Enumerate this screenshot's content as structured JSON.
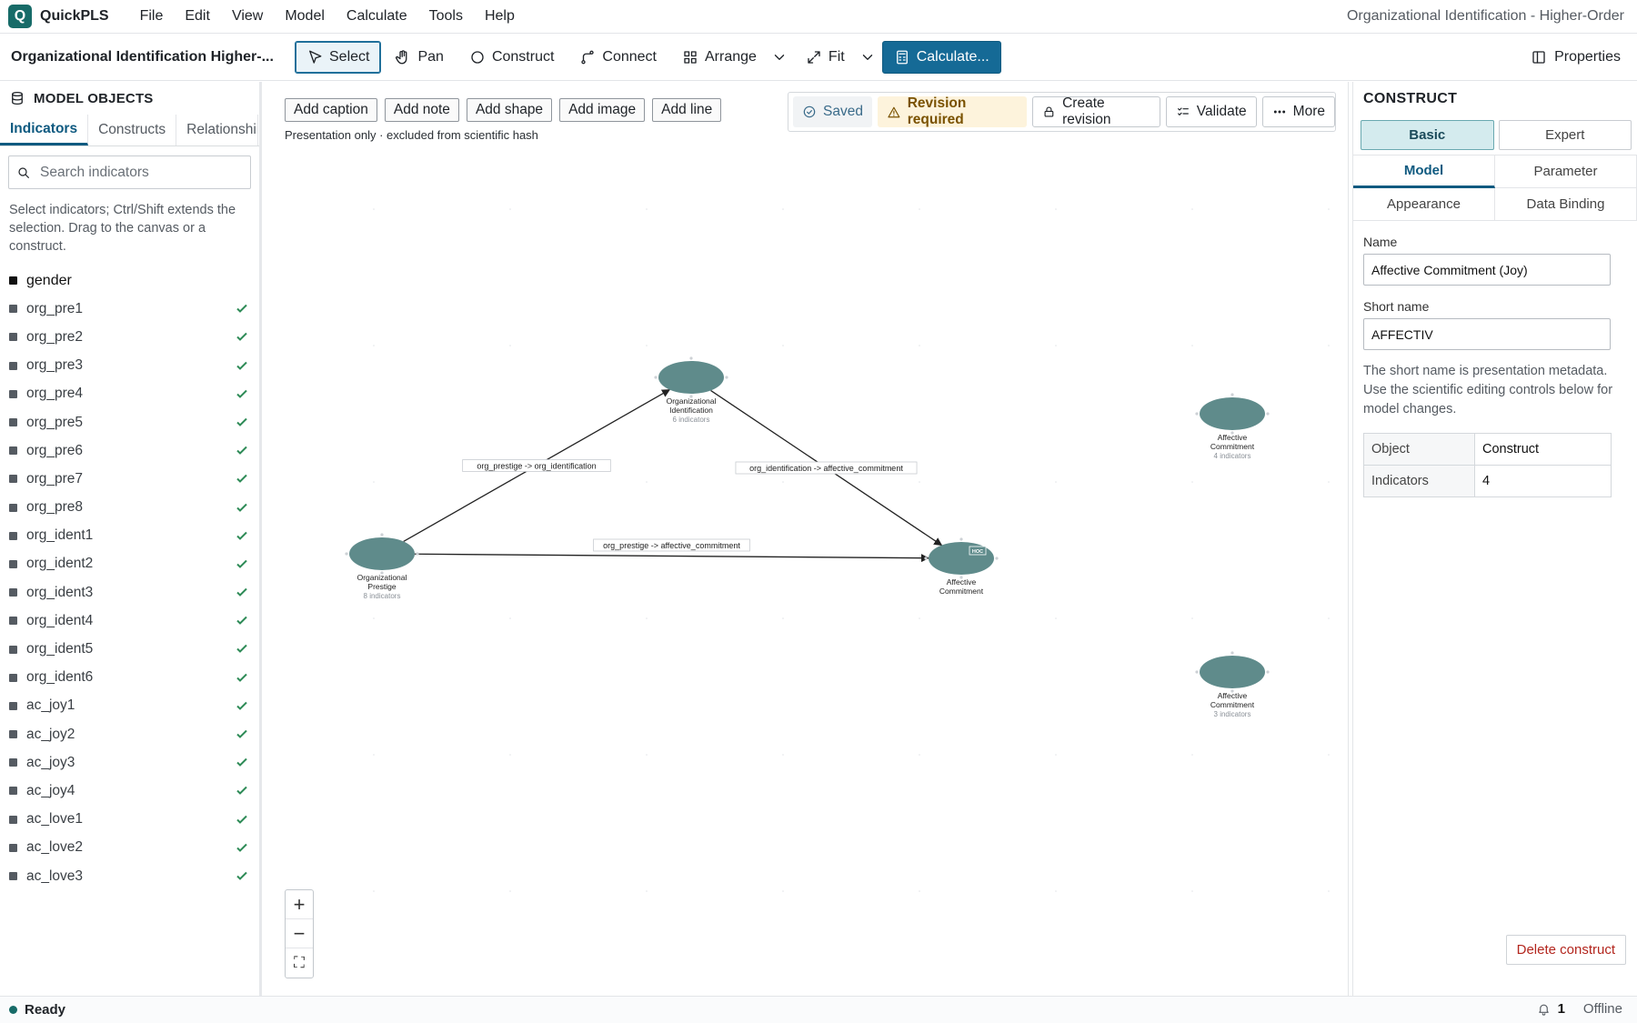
{
  "app": {
    "name": "QuickPLS",
    "logo_letter": "Q",
    "window_title": "Organizational Identification - Higher-Order"
  },
  "menu": [
    "File",
    "Edit",
    "View",
    "Model",
    "Calculate",
    "Tools",
    "Help"
  ],
  "toolbar": {
    "model_title": "Organizational Identification Higher-...",
    "select": "Select",
    "pan": "Pan",
    "construct": "Construct",
    "connect": "Connect",
    "arrange": "Arrange",
    "fit": "Fit",
    "calculate": "Calculate...",
    "properties": "Properties"
  },
  "left_panel": {
    "title": "MODEL OBJECTS",
    "tabs": [
      "Indicators",
      "Constructs",
      "Relationshi..."
    ],
    "search_placeholder": "Search indicators",
    "hint": "Select indicators; Ctrl/Shift extends the selection. Drag to the canvas or a construct.",
    "indicators": [
      {
        "name": "gender",
        "assigned": false
      },
      {
        "name": "org_pre1",
        "assigned": true
      },
      {
        "name": "org_pre2",
        "assigned": true
      },
      {
        "name": "org_pre3",
        "assigned": true
      },
      {
        "name": "org_pre4",
        "assigned": true
      },
      {
        "name": "org_pre5",
        "assigned": true
      },
      {
        "name": "org_pre6",
        "assigned": true
      },
      {
        "name": "org_pre7",
        "assigned": true
      },
      {
        "name": "org_pre8",
        "assigned": true
      },
      {
        "name": "org_ident1",
        "assigned": true
      },
      {
        "name": "org_ident2",
        "assigned": true
      },
      {
        "name": "org_ident3",
        "assigned": true
      },
      {
        "name": "org_ident4",
        "assigned": true
      },
      {
        "name": "org_ident5",
        "assigned": true
      },
      {
        "name": "org_ident6",
        "assigned": true
      },
      {
        "name": "ac_joy1",
        "assigned": true
      },
      {
        "name": "ac_joy2",
        "assigned": true
      },
      {
        "name": "ac_joy3",
        "assigned": true
      },
      {
        "name": "ac_joy4",
        "assigned": true
      },
      {
        "name": "ac_love1",
        "assigned": true
      },
      {
        "name": "ac_love2",
        "assigned": true
      },
      {
        "name": "ac_love3",
        "assigned": true
      }
    ]
  },
  "canvas": {
    "buttons": [
      "Add caption",
      "Add note",
      "Add shape",
      "Add image",
      "Add line"
    ],
    "note": "Presentation only · excluded from scientific hash",
    "status": {
      "saved": "Saved",
      "revision": "Revision required",
      "create_revision": "Create revision",
      "validate": "Validate",
      "more": "More"
    },
    "nodes": [
      {
        "id": "oi",
        "label_lines": [
          "Organizational",
          "Identification"
        ],
        "sub": "6 indicators"
      },
      {
        "id": "op",
        "label_lines": [
          "Organizational",
          "Prestige"
        ],
        "sub": "8 indicators"
      },
      {
        "id": "ac",
        "label_lines": [
          "Affective",
          "Commitment"
        ],
        "sub": "",
        "badge": "HOC"
      },
      {
        "id": "acj",
        "label_lines": [
          "Affective",
          "Commitment"
        ],
        "sub": "4 indicators"
      },
      {
        "id": "acl",
        "label_lines": [
          "Affective",
          "Commitment"
        ],
        "sub": "3 indicators"
      }
    ],
    "paths": [
      {
        "from": "op",
        "to": "oi",
        "label": "org_prestige -> org_identification"
      },
      {
        "from": "oi",
        "to": "ac",
        "label": "org_identification -> affective_commitment"
      },
      {
        "from": "op",
        "to": "ac",
        "label": "org_prestige -> affective_commitment"
      }
    ],
    "zoom": {
      "in": "+",
      "out": "−",
      "fit": "⛶"
    }
  },
  "right_panel": {
    "title": "CONSTRUCT",
    "modes": [
      "Basic",
      "Expert"
    ],
    "tabs": [
      "Model",
      "Parameter",
      "Appearance",
      "Data Binding"
    ],
    "name_label": "Name",
    "name_value": "Affective Commitment (Joy)",
    "short_label": "Short name",
    "short_value": "AFFECTIV",
    "help": "The short name is presentation metadata. Use the scientific editing controls below for model changes.",
    "table": [
      {
        "k": "Object",
        "v": "Construct"
      },
      {
        "k": "Indicators",
        "v": "4"
      }
    ],
    "delete": "Delete construct"
  },
  "statusbar": {
    "state": "Ready",
    "notifications": "1",
    "connection": "Offline"
  },
  "colors": {
    "accent": "#156a96",
    "brand": "#176b68",
    "construct_fill": "#5f8b8b",
    "check": "#2e8b57",
    "warning_bg": "#fdf3dc",
    "danger": "#b3261e"
  }
}
